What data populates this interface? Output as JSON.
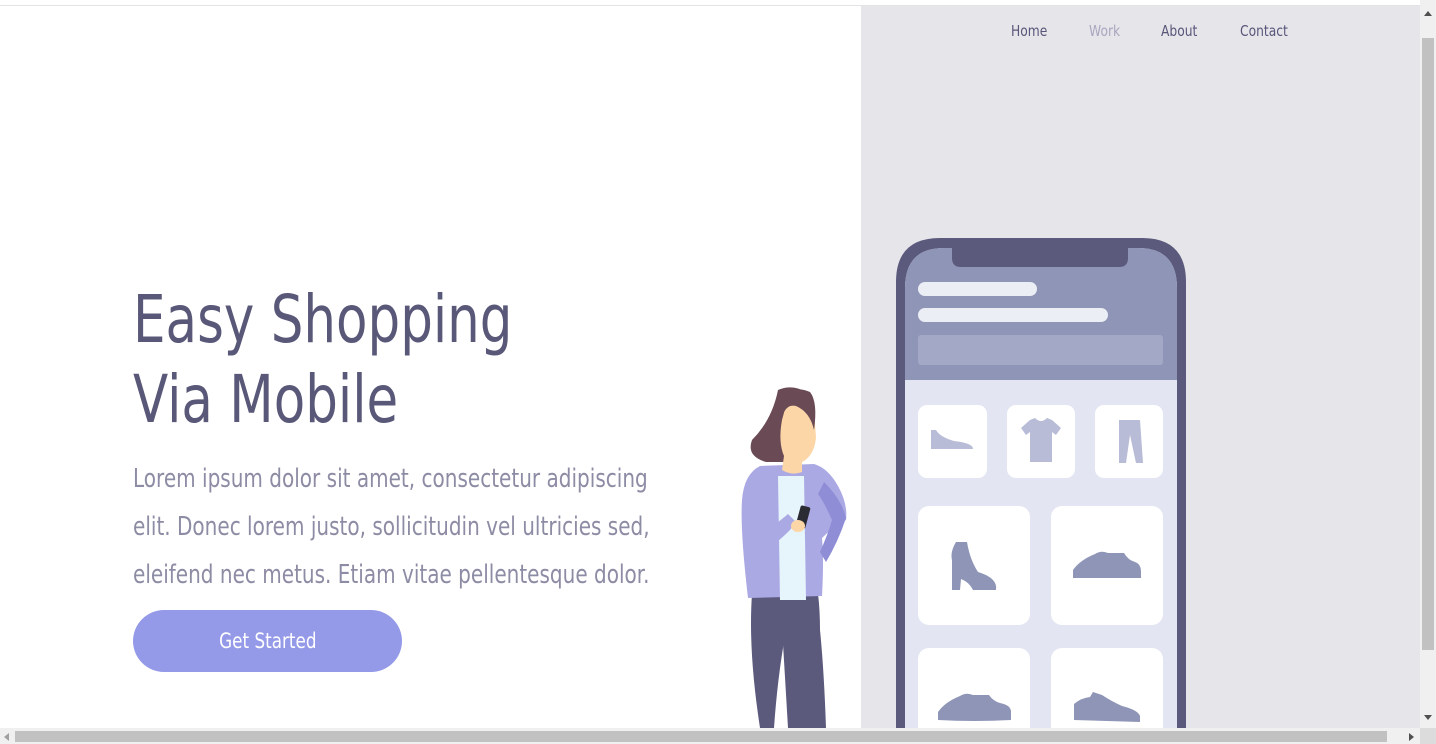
{
  "nav": {
    "items": [
      {
        "label": "Home",
        "active": false
      },
      {
        "label": "Work",
        "active": true
      },
      {
        "label": "About",
        "active": false
      },
      {
        "label": "Contact",
        "active": false
      }
    ]
  },
  "hero": {
    "title_line1": "Easy Shopping",
    "title_line2": "Via Mobile",
    "description": "Lorem ipsum dolor sit amet, consectetur adipiscing elit. Donec lorem justo, sollicitudin vel ultricies sed, eleifend nec metus. Etiam vitae pellentesque dolor.",
    "cta_label": "Get Started"
  },
  "colors": {
    "title": "#595878",
    "body_text": "#8d8ca5",
    "accent": "#9499e8",
    "panel_bg": "#e6e5ea",
    "phone_frame": "#5b5a7d"
  },
  "illustration": {
    "icons": [
      "shoe-icon",
      "tshirt-icon",
      "pants-icon",
      "boot-icon",
      "sneaker-icon",
      "sneaker-icon",
      "sneaker-icon"
    ]
  }
}
